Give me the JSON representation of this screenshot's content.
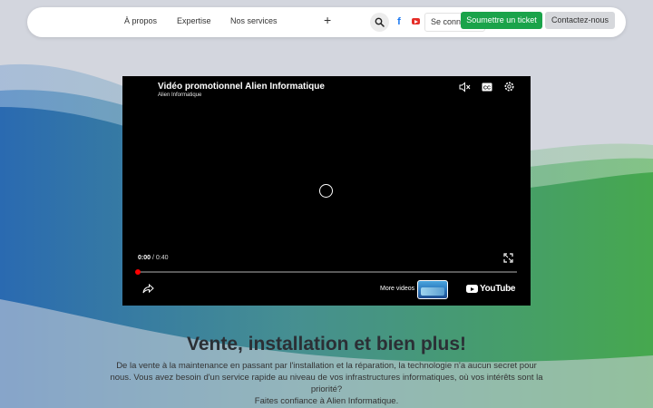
{
  "nav": {
    "links": [
      "À propos",
      "Expertise",
      "Nos services"
    ],
    "more": "+",
    "login": "Se connecter",
    "ticket": "Soumettre un ticket",
    "contact": "Contactez-nous"
  },
  "video": {
    "title": "Vidéo promotionnel Alien Informatique",
    "channel": "Alien Informatique",
    "current_time": "0:00",
    "separator": " / ",
    "duration": "0:40",
    "progress_fraction": 0,
    "more_videos": "More videos",
    "brand": "YouTube",
    "cc_label": "CC"
  },
  "hero": {
    "title": "Vente, installation et bien plus!",
    "description": "De la vente à la maintenance en passant par l'installation et la réparation, la technologie n'a aucun secret pour nous. Vous avez besoin d'un service rapide au niveau de vos infrastructures informatiques, où vos intérêts sont la priorité?",
    "trust": "Faites confiance à Alien Informatique."
  },
  "colors": {
    "ticket_green": "#1aa34a",
    "progress_red": "#ff0000",
    "facebook_blue": "#1877f2",
    "youtube_red": "#e52d27",
    "wave_blue": "#2d6fb3",
    "wave_green": "#4caf50"
  },
  "icons": {
    "search": "search-icon",
    "facebook": "facebook-icon",
    "youtube": "youtube-icon",
    "mute": "mute-icon",
    "captions": "captions-icon",
    "settings": "gear-icon",
    "fullscreen": "fullscreen-icon",
    "share": "share-icon",
    "loading": "loading-spinner-icon"
  }
}
